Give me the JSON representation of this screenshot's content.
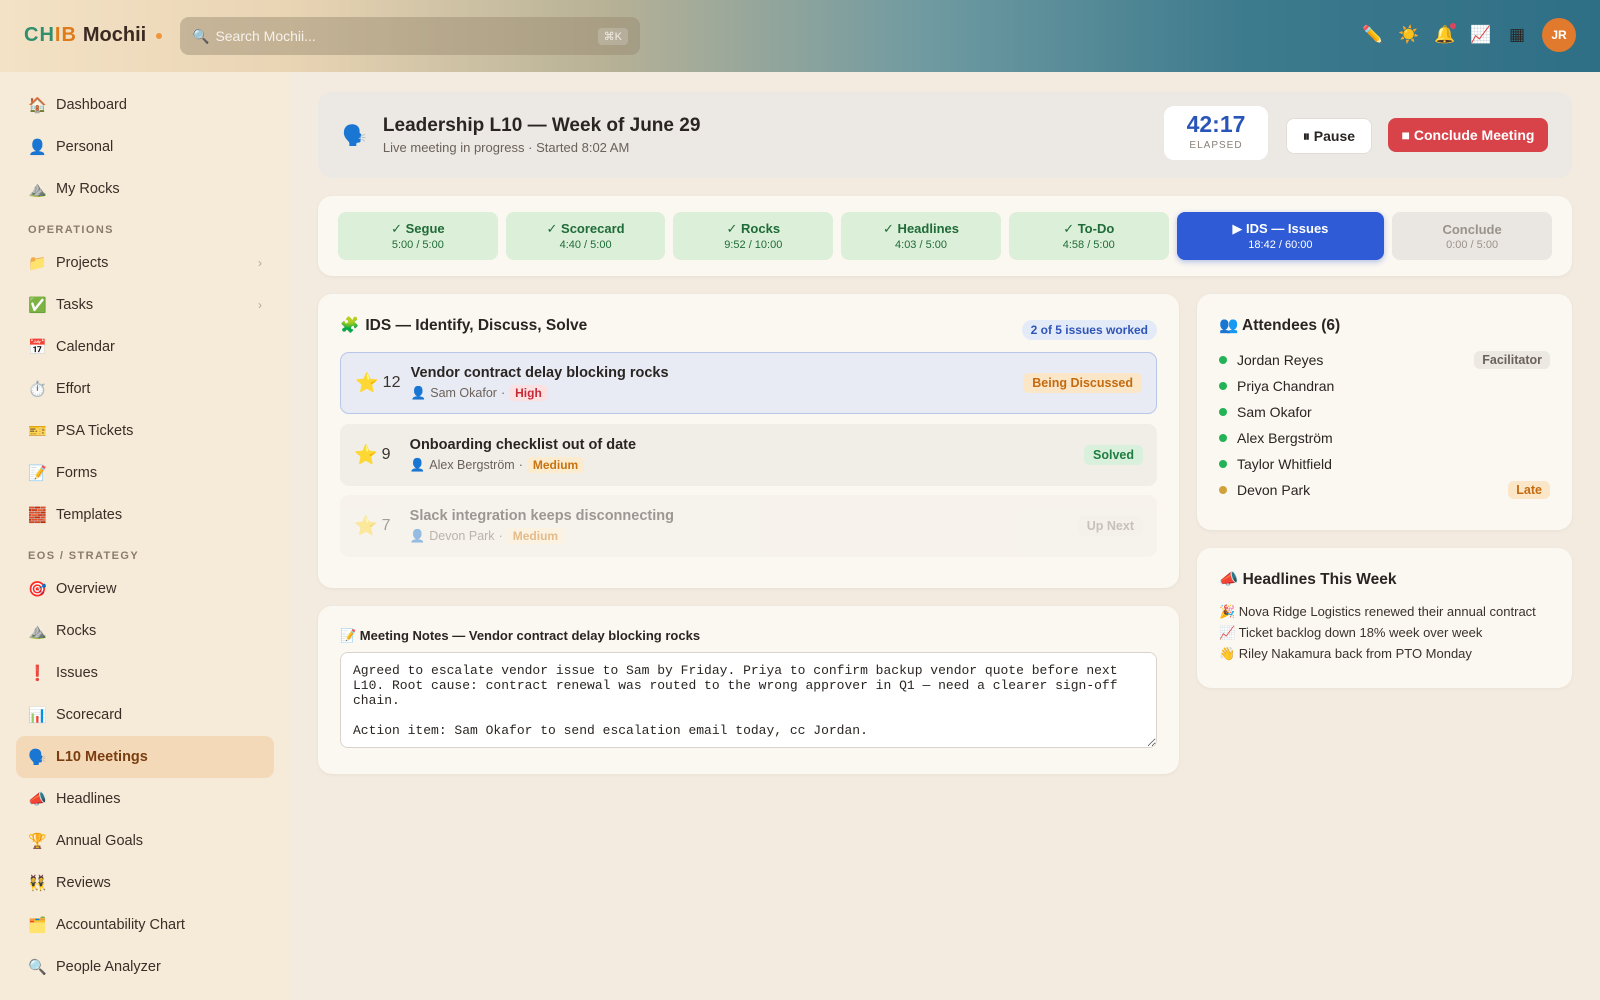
{
  "app": {
    "brand_a": "CHIB",
    "brand_b": "Mochii"
  },
  "search": {
    "placeholder": "Search Mochii...",
    "shortcut": "⌘K"
  },
  "user": {
    "initials": "JR"
  },
  "top_icons": [
    "pencil-icon",
    "sun-icon",
    "bell-icon",
    "chart-icon",
    "grid-icon"
  ],
  "sidebar": {
    "items_top": [
      {
        "label": "Dashboard",
        "icon": "🏠"
      },
      {
        "label": "Personal",
        "icon": "👤"
      },
      {
        "label": "My Rocks",
        "icon": "⛰️"
      }
    ],
    "section_operations": "OPERATIONS",
    "items_ops": [
      {
        "label": "Projects",
        "icon": "📁",
        "chevron": "›"
      },
      {
        "label": "Tasks",
        "icon": "✅",
        "chevron": "›"
      },
      {
        "label": "Calendar",
        "icon": "📅"
      },
      {
        "label": "Effort",
        "icon": "⏱️"
      },
      {
        "label": "PSA Tickets",
        "icon": "🎫"
      },
      {
        "label": "Forms",
        "icon": "📝"
      },
      {
        "label": "Templates",
        "icon": "🧱"
      }
    ],
    "section_eos": "EOS / STRATEGY",
    "items_eos": [
      {
        "label": "Overview",
        "icon": "🎯"
      },
      {
        "label": "Rocks",
        "icon": "⛰️"
      },
      {
        "label": "Issues",
        "icon": "❗"
      },
      {
        "label": "Scorecard",
        "icon": "📊"
      },
      {
        "label": "L10 Meetings",
        "icon": "🗣️"
      },
      {
        "label": "Headlines",
        "icon": "📣"
      },
      {
        "label": "Annual Goals",
        "icon": "🏆"
      },
      {
        "label": "Reviews",
        "icon": "👯"
      },
      {
        "label": "Accountability Chart",
        "icon": "🗂️"
      },
      {
        "label": "People Analyzer",
        "icon": "🔍"
      }
    ]
  },
  "meeting": {
    "icon": "🗣️",
    "title": "Leadership L10 — Week of June 29",
    "subtitle": "Live meeting in progress · Started 8:02 AM",
    "timer": "42:17",
    "timer_label": "ELAPSED",
    "pause_label": "⏸ Pause",
    "conclude_label": "■ Conclude Meeting"
  },
  "agenda": [
    {
      "label": "✓ Segue",
      "time": "5:00 / 5:00",
      "state": "done"
    },
    {
      "label": "✓ Scorecard",
      "time": "4:40 / 5:00",
      "state": "done"
    },
    {
      "label": "✓ Rocks",
      "time": "9:52 / 10:00",
      "state": "done"
    },
    {
      "label": "✓ Headlines",
      "time": "4:03 / 5:00",
      "state": "done"
    },
    {
      "label": "✓ To-Do",
      "time": "4:58 / 5:00",
      "state": "done"
    },
    {
      "label": "▶ IDS — Issues",
      "time": "18:42 / 60:00",
      "state": "current"
    },
    {
      "label": "Conclude",
      "time": "0:00 / 5:00",
      "state": "pending"
    }
  ],
  "ids": {
    "icon": "🧩",
    "title": "IDS — Identify, Discuss, Solve",
    "count": "2 of 5 issues worked",
    "issues": [
      {
        "votes": "12",
        "title": "Vendor contract delay blocking rocks",
        "owner": "Sam Okafor",
        "priority": "High",
        "status": "Being Discussed"
      },
      {
        "votes": "9",
        "title": "Onboarding checklist out of date",
        "owner": "Alex Bergström",
        "priority": "Medium",
        "status": "Solved"
      },
      {
        "votes": "7",
        "title": "Slack integration keeps disconnecting",
        "owner": "Devon Park",
        "priority": "Medium",
        "status": "Up Next"
      }
    ]
  },
  "notes": {
    "title": "📝 Meeting Notes — Vendor contract delay blocking rocks",
    "text": "Agreed to escalate vendor issue to Sam by Friday. Priya to confirm backup vendor quote before next L10. Root cause: contract renewal was routed to the wrong approver in Q1 — need a clearer sign-off chain.\n\nAction item: Sam Okafor to send escalation email today, cc Jordan."
  },
  "attendees": {
    "title": "👥 Attendees (6)",
    "list": [
      {
        "name": "Jordan Reyes",
        "role": "Facilitator"
      },
      {
        "name": "Priya Chandran",
        "role": ""
      },
      {
        "name": "Sam Okafor",
        "role": ""
      },
      {
        "name": "Alex Bergström",
        "role": ""
      },
      {
        "name": "Taylor Whitfield",
        "role": ""
      },
      {
        "name": "Devon Park",
        "role": "Late"
      }
    ]
  },
  "headlines": {
    "title": "📣 Headlines This Week",
    "list": [
      "🎉 Nova Ridge Logistics renewed their annual contract",
      "📈 Ticket backlog down 18% week over week",
      "👋 Riley Nakamura back from PTO Monday"
    ]
  },
  "colors": {
    "accent_blue": "#2f5bd6",
    "conclude_red": "#d8434a",
    "active_nav": "#f4d9b8"
  }
}
